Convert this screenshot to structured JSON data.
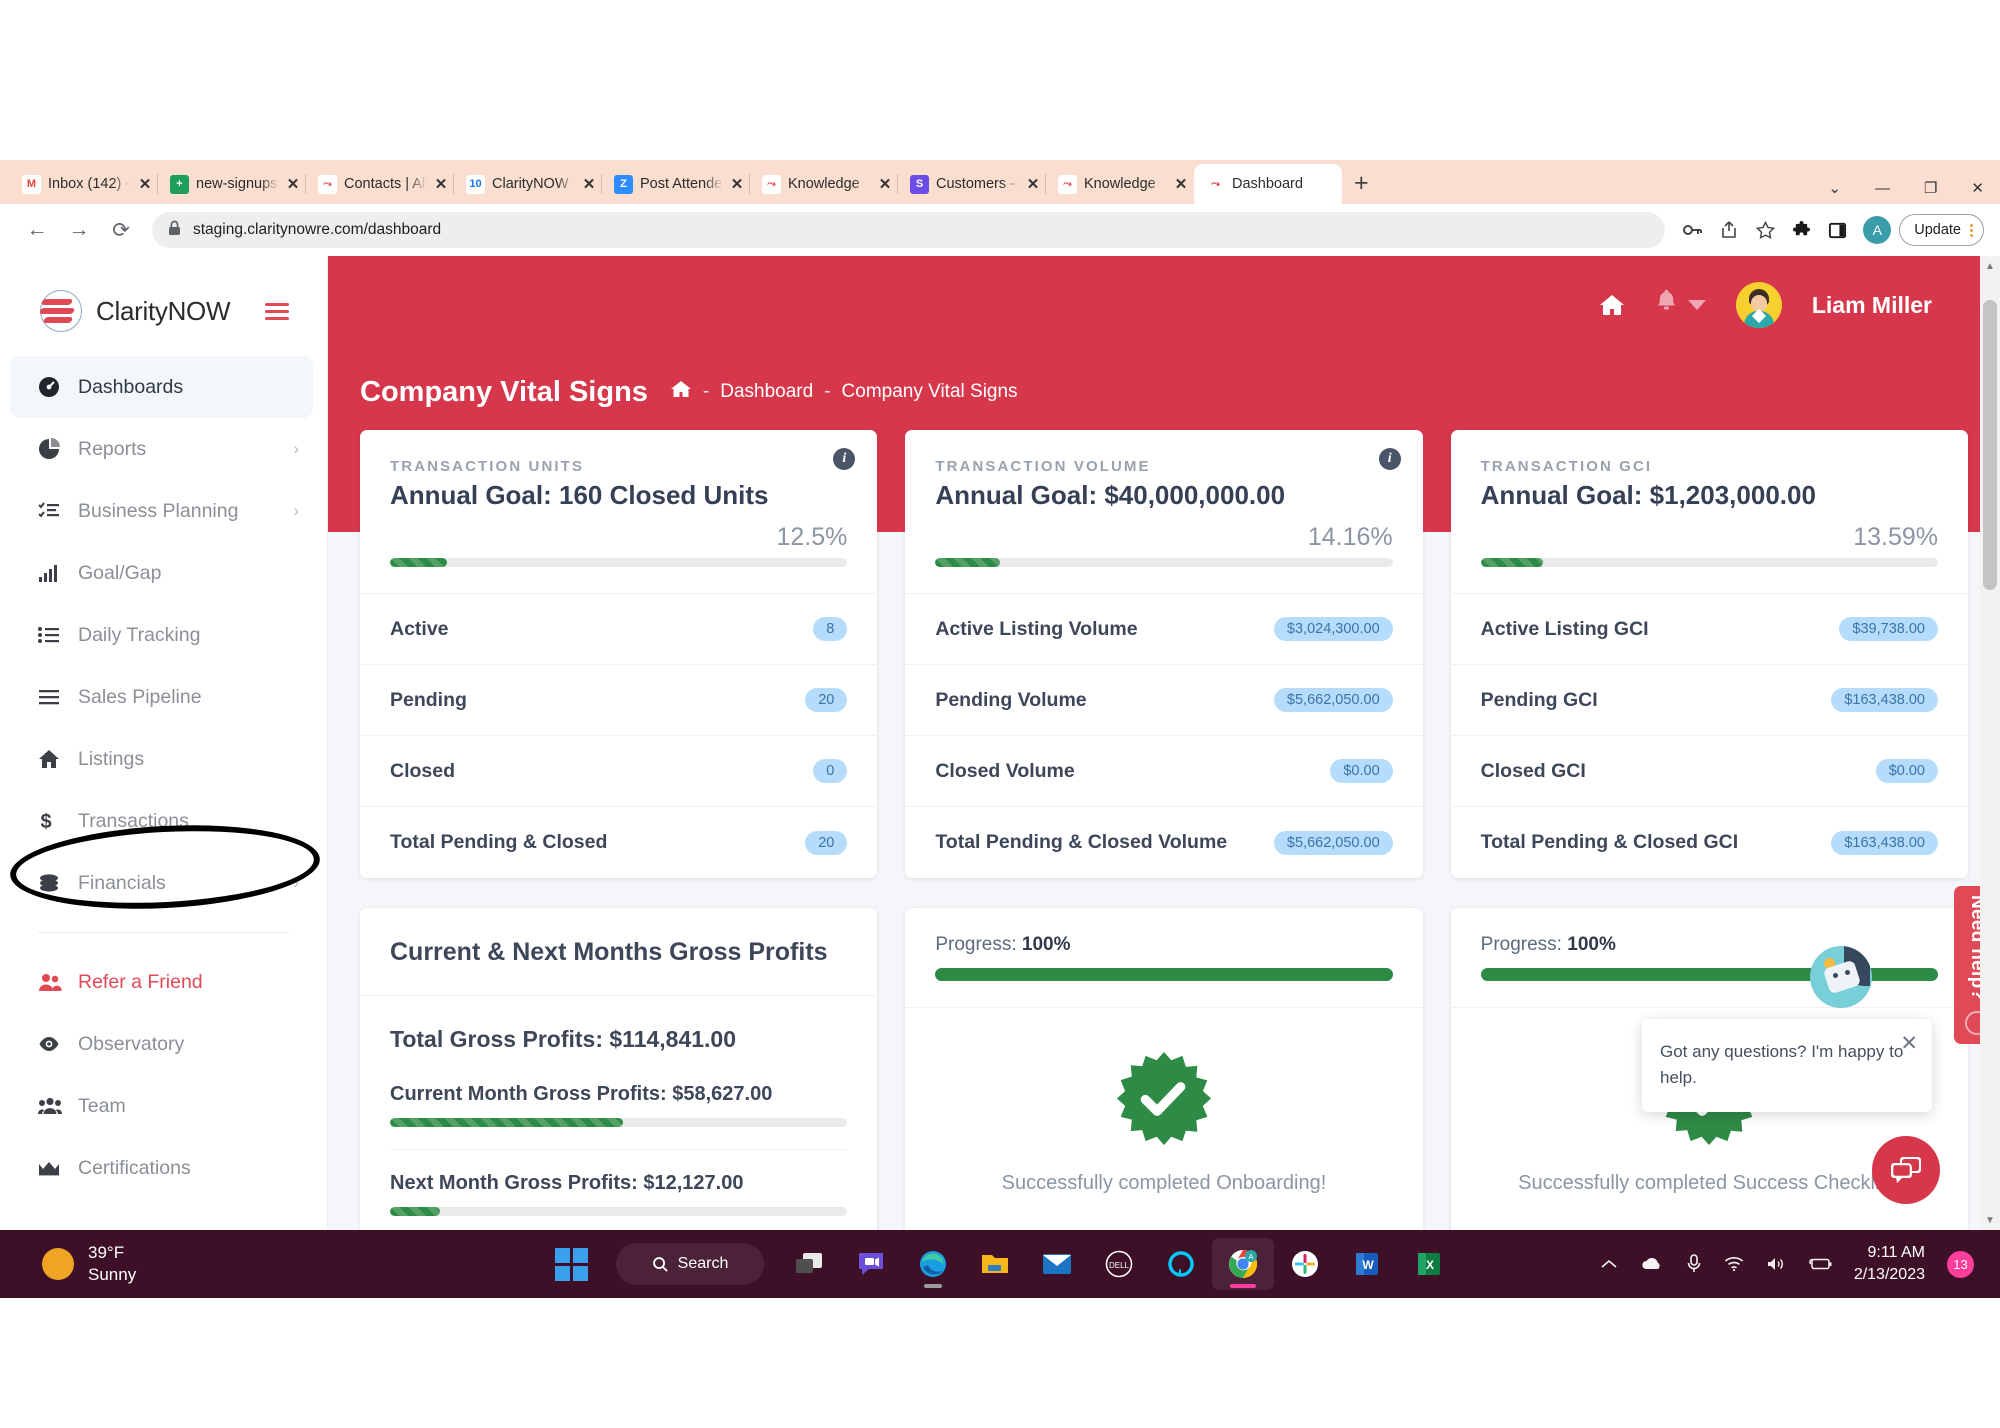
{
  "browser": {
    "tabs": [
      {
        "title": "Inbox (142) - a",
        "favicon": "gmail-icon",
        "fav_bg": "#ffffff",
        "fav_text": "M",
        "fav_color": "#ea4335",
        "active": false
      },
      {
        "title": "new-signups -",
        "favicon": "sheets-icon",
        "fav_bg": "#1e9e5a",
        "fav_text": "+",
        "fav_color": "#ffffff",
        "active": false
      },
      {
        "title": "Contacts | All c",
        "favicon": "clarity-icon",
        "fav_bg": "#ffffff",
        "fav_text": "⤳",
        "fav_color": "#e04a57",
        "active": false
      },
      {
        "title": "ClarityNOW - C",
        "favicon": "calendar-icon",
        "fav_bg": "#ffffff",
        "fav_text": "10",
        "fav_color": "#1a73e8",
        "active": false
      },
      {
        "title": "Post Attendee",
        "favicon": "zoom-icon",
        "fav_bg": "#2d8cff",
        "fav_text": "Z",
        "fav_color": "#ffffff",
        "active": false
      },
      {
        "title": "Knowledge",
        "favicon": "clarity-icon",
        "fav_bg": "#ffffff",
        "fav_text": "⤳",
        "fav_color": "#e04a57",
        "active": false
      },
      {
        "title": "Customers – C",
        "favicon": "slack-icon",
        "fav_bg": "#6b4ce6",
        "fav_text": "S",
        "fav_color": "#ffffff",
        "active": false
      },
      {
        "title": "Knowledge",
        "favicon": "clarity-icon",
        "fav_bg": "#ffffff",
        "fav_text": "⤳",
        "fav_color": "#e04a57",
        "active": false
      },
      {
        "title": "Dashboard",
        "favicon": "clarity-icon",
        "fav_bg": "#ffffff",
        "fav_text": "⤳",
        "fav_color": "#d6374b",
        "active": true
      }
    ],
    "new_tab_label": "+",
    "close_label": "✕",
    "window_controls": {
      "minimize": "—",
      "maximize": "❐",
      "close": "✕",
      "more": "⌄"
    },
    "nav": {
      "back": "←",
      "forward": "→",
      "reload": "⟳"
    },
    "url": "staging.claritynowre.com/dashboard",
    "lock_icon": "lock-icon",
    "toolbar_icons": [
      "key-icon",
      "share-icon",
      "star-icon",
      "extensions-icon",
      "sidepanel-icon"
    ],
    "profile_initial": "A",
    "update_label": "Update"
  },
  "sidebar": {
    "brand": "ClarityNOW",
    "items": [
      {
        "label": "Dashboards",
        "icon": "speedometer-icon",
        "active": true,
        "chevron": false,
        "accent": false
      },
      {
        "label": "Reports",
        "icon": "pie-chart-icon",
        "active": false,
        "chevron": true,
        "accent": false
      },
      {
        "label": "Business Planning",
        "icon": "checklist-icon",
        "active": false,
        "chevron": true,
        "accent": false
      },
      {
        "label": "Goal/Gap",
        "icon": "bar-chart-icon",
        "active": false,
        "chevron": false,
        "accent": false
      },
      {
        "label": "Daily Tracking",
        "icon": "list-icon",
        "active": false,
        "chevron": false,
        "accent": false
      },
      {
        "label": "Sales Pipeline",
        "icon": "pipeline-icon",
        "active": false,
        "chevron": false,
        "accent": false
      },
      {
        "label": "Listings",
        "icon": "home-icon",
        "active": false,
        "chevron": false,
        "accent": false
      },
      {
        "label": "Transactions",
        "icon": "dollar-icon",
        "active": false,
        "chevron": false,
        "accent": false
      },
      {
        "label": "Financials",
        "icon": "coins-icon",
        "active": false,
        "chevron": true,
        "accent": false
      }
    ],
    "items_secondary": [
      {
        "label": "Refer a Friend",
        "icon": "people-icon",
        "accent": true,
        "chevron": false
      },
      {
        "label": "Observatory",
        "icon": "eye-icon",
        "accent": false,
        "chevron": false
      },
      {
        "label": "Team",
        "icon": "team-icon",
        "accent": false,
        "chevron": false
      },
      {
        "label": "Certifications",
        "icon": "crown-icon",
        "accent": false,
        "chevron": false
      }
    ]
  },
  "topbar": {
    "home_icon": "home-icon",
    "bell_icon": "bell-icon",
    "user_name": "Liam Miller"
  },
  "page": {
    "title": "Company Vital Signs",
    "breadcrumb": [
      {
        "label": "",
        "icon": "home-icon"
      },
      {
        "label": "Dashboard"
      },
      {
        "label": "Company Vital Signs"
      }
    ],
    "separator": "-"
  },
  "cards": [
    {
      "kicker": "TRANSACTION UNITS",
      "goal": "Annual Goal: 160 Closed Units",
      "percent_label": "12.5%",
      "percent_value": 12.5,
      "info_icon": "info-icon",
      "has_info": true,
      "rows": [
        {
          "label": "Active",
          "value": "8"
        },
        {
          "label": "Pending",
          "value": "20"
        },
        {
          "label": "Closed",
          "value": "0"
        },
        {
          "label": "Total Pending & Closed",
          "value": "20"
        }
      ]
    },
    {
      "kicker": "TRANSACTION VOLUME",
      "goal": "Annual Goal: $40,000,000.00",
      "percent_label": "14.16%",
      "percent_value": 14.16,
      "info_icon": "info-icon",
      "has_info": true,
      "rows": [
        {
          "label": "Active Listing Volume",
          "value": "$3,024,300.00"
        },
        {
          "label": "Pending Volume",
          "value": "$5,662,050.00"
        },
        {
          "label": "Closed Volume",
          "value": "$0.00"
        },
        {
          "label": "Total Pending & Closed Volume",
          "value": "$5,662,050.00"
        }
      ]
    },
    {
      "kicker": "TRANSACTION GCI",
      "goal": "Annual Goal: $1,203,000.00",
      "percent_label": "13.59%",
      "percent_value": 13.59,
      "info_icon": "info-icon",
      "has_info": false,
      "rows": [
        {
          "label": "Active Listing GCI",
          "value": "$39,738.00"
        },
        {
          "label": "Pending GCI",
          "value": "$163,438.00"
        },
        {
          "label": "Closed GCI",
          "value": "$0.00"
        },
        {
          "label": "Total Pending & Closed GCI",
          "value": "$163,438.00"
        }
      ]
    }
  ],
  "profits_card": {
    "title": "Current & Next Months Gross Profits",
    "total": "Total Gross Profits: $114,841.00",
    "current": "Current Month Gross Profits: $58,627.00",
    "current_percent": 51,
    "next": "Next Month Gross Profits: $12,127.00",
    "next_percent": 11
  },
  "progress_cards": [
    {
      "progress_prefix": "Progress:",
      "progress_value": "100%",
      "fill_percent": 100,
      "seal_icon": "verified-check-icon",
      "caption": "Successfully completed Onboarding!"
    },
    {
      "progress_prefix": "Progress:",
      "progress_value": "100%",
      "fill_percent": 100,
      "seal_icon": "verified-check-icon",
      "caption": "Successfully completed Success Checklist!"
    }
  ],
  "help_tab": {
    "label": "Need help?",
    "icon": "lifebuoy-icon"
  },
  "chat": {
    "message": "Got any questions? I'm happy to help.",
    "close_label": "✕",
    "bot_icon": "robot-avatar-icon",
    "fab_icon": "chat-bubble-icon"
  },
  "taskbar": {
    "weather_temp": "39°F",
    "weather_desc": "Sunny",
    "search_label": "Search",
    "apps": [
      {
        "name": "start-button",
        "icon": "windows-logo-icon",
        "running": false,
        "active": false
      },
      {
        "name": "task-view",
        "icon": "task-view-icon",
        "running": false,
        "active": false
      },
      {
        "name": "teams",
        "icon": "teams-chat-icon",
        "running": false,
        "active": false
      },
      {
        "name": "edge",
        "icon": "edge-icon",
        "running": true,
        "active": false
      },
      {
        "name": "file-explorer",
        "icon": "folder-icon",
        "running": false,
        "active": false
      },
      {
        "name": "mail",
        "icon": "mail-icon",
        "running": false,
        "active": false
      },
      {
        "name": "dell",
        "icon": "dell-icon",
        "running": false,
        "active": false
      },
      {
        "name": "alexa",
        "icon": "alexa-icon",
        "running": false,
        "active": false
      },
      {
        "name": "chrome",
        "icon": "chrome-icon",
        "running": true,
        "active": true
      },
      {
        "name": "slack",
        "icon": "slack-icon",
        "running": true,
        "active": false
      },
      {
        "name": "word",
        "icon": "word-icon",
        "running": true,
        "active": false
      },
      {
        "name": "excel",
        "icon": "excel-icon",
        "running": true,
        "active": false
      }
    ],
    "tray_icons": [
      "chevron-up-icon",
      "onedrive-icon",
      "microphone-icon",
      "wifi-icon",
      "speaker-icon",
      "battery-icon"
    ],
    "time": "9:11 AM",
    "date": "2/13/2023",
    "notification_count": "13"
  },
  "colors": {
    "brand_red": "#d6374b",
    "accent_red": "#e04a57",
    "green": "#2e8b45",
    "badge_blue": "#b5dcfb",
    "taskbar": "#3d1028"
  }
}
